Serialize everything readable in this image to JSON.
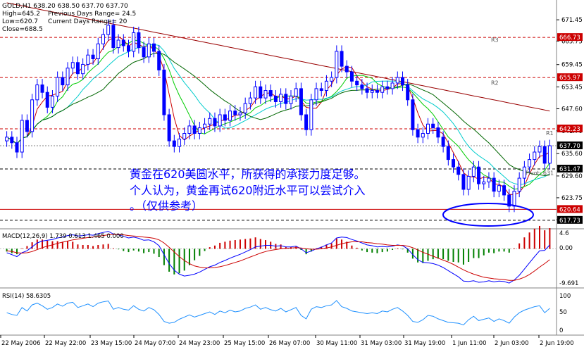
{
  "colors": {
    "background": "#ffffff",
    "candle": "#0000ff",
    "ma_red": "#cc0000",
    "ma_darkgreen": "#006600",
    "ma_green": "#00cc00",
    "ma_cyan": "#00cccc",
    "ma_darkred": "#990000",
    "level_line": "#cc0000",
    "level_label_bg": "#cc0000",
    "annotation_text": "#0000ff",
    "macd_line": "#0000ff",
    "signal_line": "#cc0000",
    "hist_pos": "#cc0000",
    "hist_neg": "#008000",
    "rsi_line": "#1e90ff",
    "grid": "#c0c0c0"
  },
  "header": {
    "line1": "GOLD,H1  638.20 638.50 637.70 637.70",
    "high": "High=645.2",
    "prev_range": "Previous Days Range= 24.5",
    "low": "Low=620.7",
    "curr_range": "Current Days Range= 20",
    "close": "Close=688.5"
  },
  "annotation": {
    "line1": "黄金在620美圆水平，所获得的承接力度足够。",
    "line2": "个人认为，黄金再试620附近水平可以尝试介入",
    "line3": "。（仅供参考）"
  },
  "macd_label": "MACD(12,26,9) 1.739 0.613 1.465 0.000",
  "rsi_label": "RSI(14) 58.6305",
  "macd_axis": [
    "4.6",
    "0.00",
    "-9.691"
  ],
  "rsi_axis": [
    "100",
    "50",
    "0"
  ],
  "chart_data": {
    "type": "candlestick",
    "symbol": "GOLD",
    "timeframe": "H1",
    "ylim": [
      616,
      676
    ],
    "price_ticks": [
      "671.45",
      "665.75",
      "659.45",
      "653.45",
      "647.60",
      "641.70",
      "635.60",
      "629.60",
      "623.75",
      "617.85"
    ],
    "x_ticks": [
      "22 May 2006",
      "22 May 22:00",
      "23 May 15:00",
      "24 May 07:00",
      "24 May 23:00",
      "25 May 15:00",
      "26 May 07:00",
      "30 May 11:00",
      "31 May 03:00",
      "31 May 19:00",
      "1 Jun 11:00",
      "2 Jun 03:00",
      "2 Jun 19:00"
    ],
    "levels": [
      {
        "label": "666.73",
        "value": 666.73,
        "style": "dash"
      },
      {
        "label": "655.97",
        "value": 655.97,
        "style": "dash"
      },
      {
        "label": "642.23",
        "value": 642.23,
        "style": "dash"
      },
      {
        "label": "637.70",
        "value": 637.7,
        "style": "current"
      },
      {
        "label": "631.47",
        "value": 631.47,
        "style": "dash"
      },
      {
        "label": "620.64",
        "value": 620.64,
        "style": "solid"
      },
      {
        "label": "617.73",
        "value": 617.73,
        "style": "dash"
      }
    ],
    "pivot_labels": [
      {
        "label": "R3",
        "value": 665.5
      },
      {
        "label": "R2",
        "value": 654.0
      },
      {
        "label": "R1",
        "value": 640.5
      },
      {
        "label": "Pivot: 631",
        "value": 629.9
      }
    ],
    "closes": [
      640.0,
      638.5,
      636.0,
      644.5,
      641.5,
      650.0,
      654.0,
      652.0,
      648.0,
      651.0,
      656.0,
      654.0,
      658.5,
      660.0,
      657.0,
      659.5,
      662.0,
      661.0,
      665.0,
      667.5,
      670.0,
      664.0,
      666.0,
      664.5,
      663.0,
      668.0,
      664.0,
      661.5,
      665.0,
      663.0,
      658.0,
      646.0,
      639.0,
      637.5,
      639.5,
      641.0,
      643.0,
      641.0,
      642.5,
      643.5,
      645.0,
      643.0,
      646.0,
      644.5,
      647.0,
      646.0,
      646.5,
      649.0,
      650.5,
      653.5,
      650.5,
      652.5,
      651.0,
      649.5,
      651.5,
      649.0,
      651.0,
      653.0,
      646.0,
      642.0,
      650.0,
      653.0,
      652.5,
      655.0,
      656.0,
      663.0,
      659.0,
      657.5,
      655.0,
      654.0,
      653.0,
      652.0,
      652.5,
      652.0,
      653.5,
      653.0,
      654.5,
      656.0,
      654.0,
      650.0,
      642.0,
      640.0,
      641.0,
      643.5,
      642.5,
      640.0,
      637.5,
      634.0,
      632.0,
      630.0,
      626.0,
      629.5,
      632.0,
      627.5,
      628.0,
      629.0,
      625.5,
      627.0,
      624.5,
      621.5,
      625.5,
      629.0,
      632.0,
      634.0,
      636.0,
      637.5,
      633.0,
      637.7
    ],
    "macd": [
      -1.0,
      -1.5,
      -2.0,
      -1.0,
      -0.5,
      0.5,
      1.5,
      2.0,
      2.2,
      2.4,
      2.8,
      3.0,
      3.4,
      3.6,
      3.3,
      3.4,
      3.6,
      3.5,
      3.9,
      4.2,
      4.5,
      3.8,
      3.6,
      3.2,
      2.8,
      3.0,
      2.7,
      2.2,
      2.3,
      1.8,
      0.8,
      -1.5,
      -3.8,
      -5.5,
      -6.5,
      -7.0,
      -6.8,
      -6.5,
      -6.0,
      -5.3,
      -4.6,
      -4.2,
      -3.5,
      -3.0,
      -2.4,
      -1.9,
      -1.4,
      -0.8,
      -0.2,
      0.5,
      0.7,
      0.9,
      0.9,
      0.7,
      0.8,
      0.5,
      0.5,
      0.7,
      0.0,
      -1.0,
      -0.6,
      0.0,
      0.4,
      1.0,
      1.5,
      2.8,
      3.0,
      2.9,
      2.4,
      2.0,
      1.5,
      1.0,
      0.8,
      0.5,
      0.6,
      0.5,
      0.7,
      1.0,
      0.8,
      0.0,
      -1.5,
      -2.8,
      -3.5,
      -3.6,
      -3.8,
      -4.2,
      -4.8,
      -5.6,
      -6.4,
      -7.2,
      -8.3,
      -8.4,
      -8.2,
      -8.6,
      -8.5,
      -8.2,
      -8.5,
      -8.3,
      -8.4,
      -8.8,
      -8.0,
      -6.8,
      -5.2,
      -3.6,
      -2.0,
      -0.5,
      -0.4,
      1.0
    ],
    "signal": [
      -0.5,
      -0.7,
      -1.0,
      -1.1,
      -1.0,
      -0.7,
      -0.2,
      0.3,
      0.7,
      1.0,
      1.4,
      1.7,
      2.0,
      2.3,
      2.5,
      2.7,
      2.9,
      3.0,
      3.2,
      3.4,
      3.6,
      3.7,
      3.7,
      3.6,
      3.4,
      3.3,
      3.2,
      3.0,
      2.9,
      2.7,
      2.3,
      1.5,
      0.4,
      -0.8,
      -2.0,
      -3.0,
      -3.8,
      -4.4,
      -4.7,
      -4.9,
      -4.9,
      -4.8,
      -4.6,
      -4.3,
      -3.9,
      -3.5,
      -3.1,
      -2.6,
      -2.1,
      -1.6,
      -1.1,
      -0.7,
      -0.4,
      -0.2,
      0.0,
      0.1,
      0.2,
      0.3,
      0.2,
      0.0,
      -0.1,
      -0.1,
      0.0,
      0.2,
      0.5,
      0.9,
      1.3,
      1.6,
      1.8,
      1.8,
      1.8,
      1.6,
      1.5,
      1.3,
      1.2,
      1.0,
      0.9,
      0.9,
      0.9,
      0.7,
      0.3,
      -0.3,
      -0.9,
      -1.4,
      -1.9,
      -2.4,
      -2.9,
      -3.4,
      -4.0,
      -4.7,
      -5.4,
      -6.0,
      -6.5,
      -6.9,
      -7.3,
      -7.5,
      -7.7,
      -7.8,
      -7.9,
      -8.1,
      -8.1,
      -7.8,
      -7.3,
      -6.6,
      -5.7,
      -4.7,
      -3.8,
      -2.8
    ],
    "rsi": [
      48,
      44,
      42,
      60,
      52,
      66,
      70,
      64,
      56,
      60,
      68,
      63,
      70,
      72,
      60,
      64,
      68,
      62,
      70,
      73,
      75,
      56,
      60,
      56,
      54,
      64,
      56,
      52,
      60,
      55,
      44,
      28,
      24,
      26,
      33,
      38,
      43,
      38,
      42,
      46,
      50,
      44,
      52,
      48,
      54,
      50,
      52,
      58,
      61,
      66,
      56,
      60,
      55,
      52,
      58,
      50,
      55,
      60,
      42,
      34,
      56,
      62,
      60,
      64,
      66,
      76,
      62,
      58,
      52,
      50,
      48,
      46,
      48,
      46,
      52,
      50,
      56,
      60,
      52,
      42,
      28,
      26,
      32,
      42,
      40,
      34,
      30,
      26,
      25,
      24,
      20,
      32,
      40,
      30,
      33,
      36,
      28,
      34,
      30,
      24,
      38,
      48,
      54,
      58,
      62,
      64,
      48,
      58
    ]
  }
}
